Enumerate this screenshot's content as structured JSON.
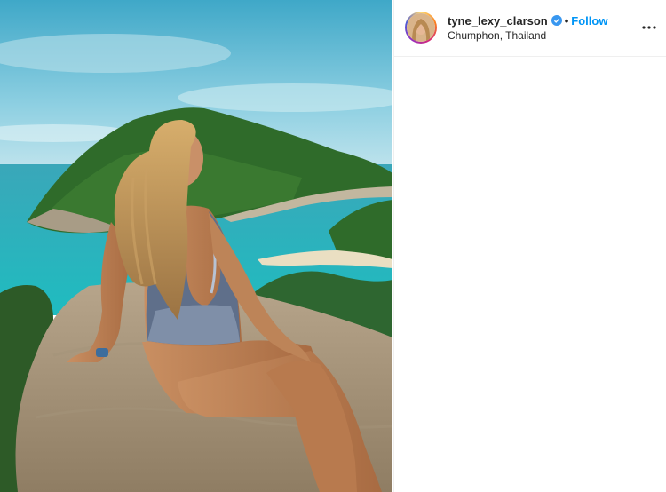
{
  "post": {
    "username": "tyne_lexy_clarson",
    "verified": true,
    "separator": "•",
    "follow_label": "Follow",
    "location": "Chumphon, Thailand"
  },
  "icons": {
    "verified": "verified-badge-icon",
    "more": "more-options-icon"
  },
  "colors": {
    "follow": "#0095f6",
    "text": "#262626",
    "verified": "#3897f0"
  }
}
